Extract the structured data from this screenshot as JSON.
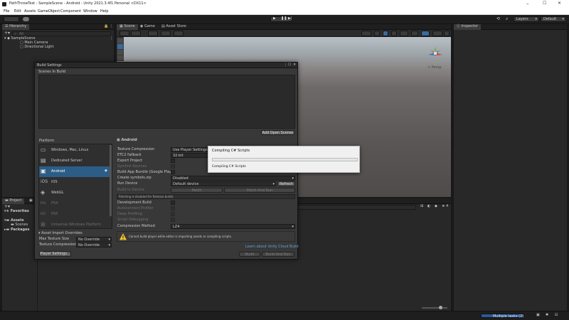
{
  "window": {
    "title": "PathThrowTest - SampleScene - Android - Unity 2021.3.4f1 Personal <DX11>",
    "controls": [
      "–",
      "☐",
      "✕"
    ]
  },
  "menu": [
    "File",
    "Edit",
    "Assets",
    "GameObject",
    "Component",
    "Window",
    "Help"
  ],
  "toolbar": {
    "layers_label": "Layers",
    "layout_label": "Default"
  },
  "hierarchy": {
    "tab": "Hierarchy",
    "search_placeholder": "All",
    "scene": "SampleScene",
    "items": [
      "Main Camera",
      "Directional Light"
    ]
  },
  "scene_tabs": [
    "Scene",
    "Game",
    "Asset Store"
  ],
  "scene_view": {
    "persp_label": "< Persp"
  },
  "inspector": {
    "tab": "Inspector"
  },
  "project": {
    "tab_project": "Project",
    "tab_console": "",
    "favorites": "Favorites",
    "assets": "Assets",
    "scenes": "Scenes",
    "packages": "Packages",
    "slider_count": "4"
  },
  "build_settings": {
    "title": "Build Settings",
    "scenes_in_build": "Scenes In Build",
    "add_open_scenes": "Add Open Scenes",
    "platform_header": "Platform",
    "platforms": [
      {
        "name": "Windows, Mac, Linux",
        "glyph": "🖥",
        "selected": false,
        "enabled": true
      },
      {
        "name": "Dedicated Server",
        "glyph": "▤",
        "selected": false,
        "enabled": true
      },
      {
        "name": "Android",
        "glyph": "🤖",
        "selected": true,
        "enabled": true
      },
      {
        "name": "iOS",
        "glyph": "iOS",
        "selected": false,
        "enabled": true
      },
      {
        "name": "WebGL",
        "glyph": "◈",
        "selected": false,
        "enabled": true
      },
      {
        "name": "PS4",
        "glyph": "PS4",
        "selected": false,
        "enabled": false
      },
      {
        "name": "PS5",
        "glyph": "PS5",
        "selected": false,
        "enabled": false
      },
      {
        "name": "Universal Windows Platform",
        "glyph": "⊞",
        "selected": false,
        "enabled": false
      }
    ],
    "selected_platform_title": "Android",
    "settings": [
      {
        "label": "Texture Compression",
        "value": "Use Player Settings",
        "kind": "dropdown",
        "enabled": true
      },
      {
        "label": "ETC2 fallback",
        "value": "32-bit",
        "kind": "dropdown",
        "enabled": true
      },
      {
        "label": "Export Project",
        "value": "",
        "kind": "checkbox",
        "enabled": true
      },
      {
        "label": "Symlink Sources",
        "value": "",
        "kind": "checkbox",
        "enabled": false
      },
      {
        "label": "Build App Bundle (Google Play)",
        "value": "",
        "kind": "checkbox",
        "enabled": true
      },
      {
        "label": "Create symbols.zip",
        "value": "Disabled",
        "kind": "dropdown",
        "enabled": true
      },
      {
        "label": "Run Device",
        "value": "Default device",
        "kind": "dropdown",
        "enabled": true
      },
      {
        "label": "Build to Device",
        "value": "",
        "kind": "buttons",
        "enabled": false
      },
      {
        "label": "",
        "value": "",
        "kind": "note",
        "enabled": true
      },
      {
        "label": "Development Build",
        "value": "",
        "kind": "checkbox",
        "enabled": true
      },
      {
        "label": "Autoconnect Profiler",
        "value": "",
        "kind": "checkbox",
        "enabled": false
      },
      {
        "label": "Deep Profiling",
        "value": "",
        "kind": "checkbox",
        "enabled": false
      },
      {
        "label": "Script Debugging",
        "value": "",
        "kind": "checkbox",
        "enabled": false
      },
      {
        "label": "Compression Method",
        "value": "LZ4",
        "kind": "dropdown",
        "enabled": true
      }
    ],
    "refresh_label": "Refresh",
    "patch_label": "Patch",
    "patch_and_run_label": "Patch And Run",
    "patching_note": "Patching is disabled for Release builds",
    "warning_text": "Cannot build player while editor is importing assets or compiling scripts.",
    "cloud_build_link": "Learn about Unity Cloud Build",
    "build_label": "Build",
    "build_and_run_label": "Build And Run",
    "asset_import_overrides": "Asset Import Overrides",
    "max_texture_size_label": "Max Texture Size",
    "max_texture_size_value": "No Override",
    "texture_compression_label": "Texture Compression",
    "texture_compression_value": "No Override",
    "player_settings_label": "Player Settings..."
  },
  "progress_dialog": {
    "title": "Compiling C# Scripts",
    "status": "Compiling C# Scripts",
    "progress": 0.0
  },
  "status_bar": {
    "tasks_label": "Multiple tasks (2)"
  },
  "colors": {
    "selection": "#2c5d87",
    "link": "#5fa2dd",
    "warning": "#f4c430"
  }
}
